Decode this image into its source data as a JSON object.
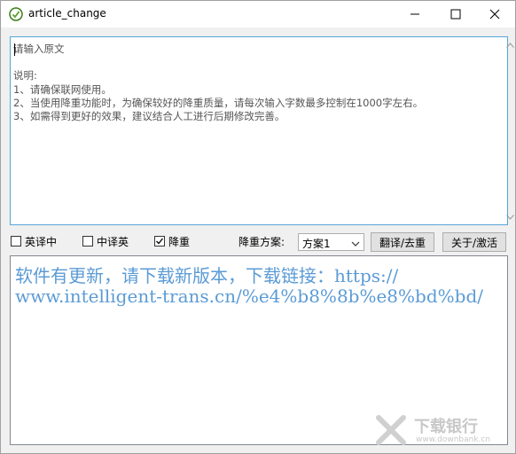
{
  "window": {
    "title": "article_change"
  },
  "input": {
    "lines": [
      "请输入原文",
      "",
      "说明:",
      "1、请确保联网使用。",
      "2、当使用降重功能时，为确保较好的降重质量，请每次输入字数最多控制在1000字左右。",
      "3、如需得到更好的效果，建议结合人工进行后期修改完善。"
    ]
  },
  "controls": {
    "cb_en_zh": {
      "label": "英译中",
      "checked": false
    },
    "cb_zh_en": {
      "label": "中译英",
      "checked": false
    },
    "cb_dedup": {
      "label": "降重",
      "checked": true
    },
    "scheme_label": "降重方案:",
    "scheme_value": "方案1",
    "translate_button": "翻译/去重",
    "about_button": "关于/激活"
  },
  "output": {
    "lines": [
      "软件有更新，请下载新版本，下载链接：https://",
      "www.intelligent-trans.cn/%e4%b8%8b%e8%bd%bd/"
    ]
  },
  "watermark": {
    "text": "下载银行",
    "url": "www.downbank.cn"
  },
  "colors": {
    "accent": "#56a5d8",
    "output_text": "#5b9bd5"
  }
}
